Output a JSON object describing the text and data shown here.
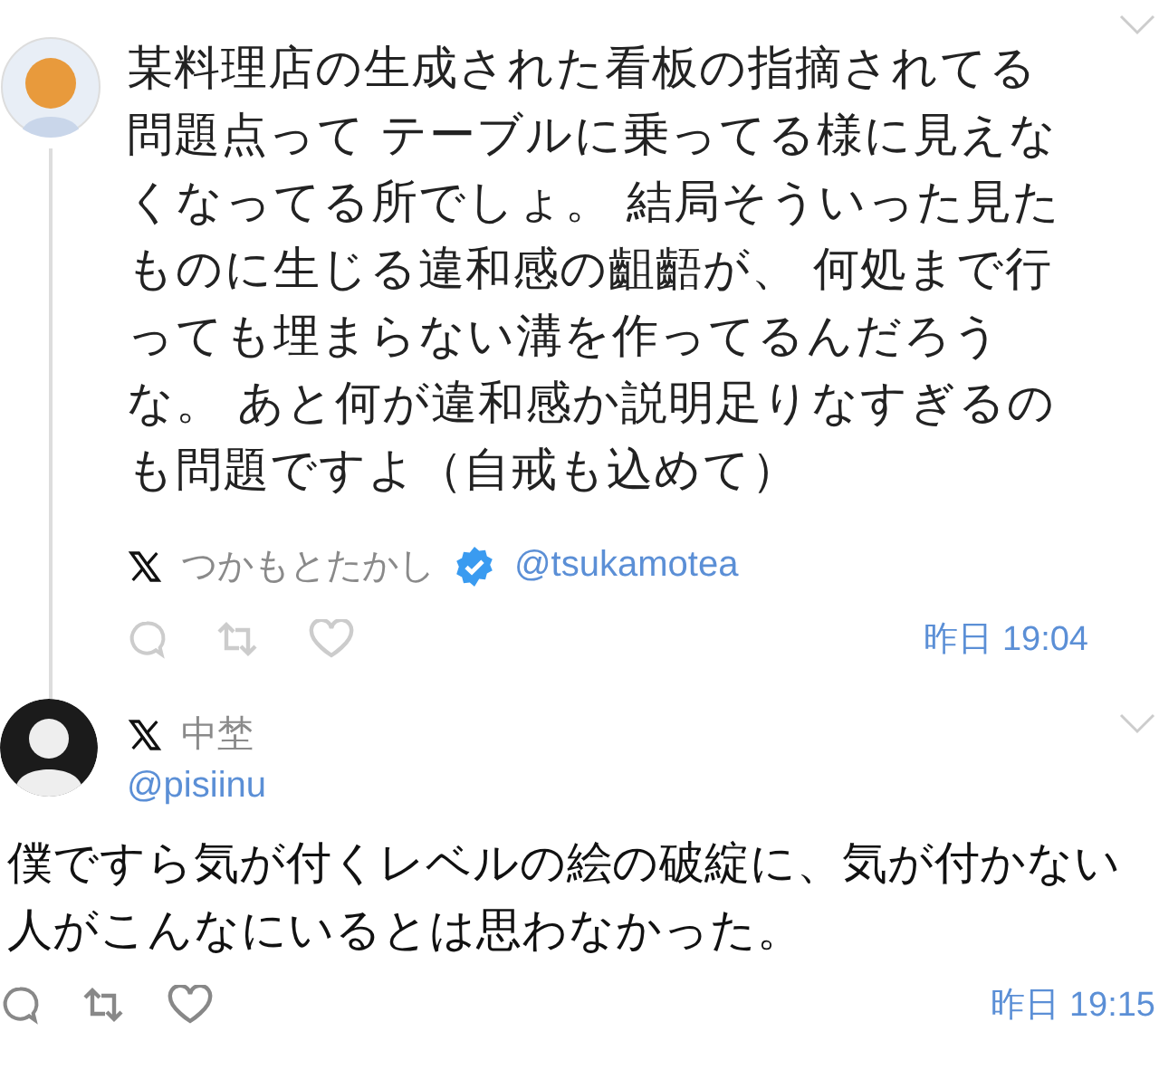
{
  "tweets": [
    {
      "kind": "indented",
      "text": "某料理店の生成された看板の指摘されてる問題点って テーブルに乗ってる様に見えなくなってる所でしょ。 結局そういった見たものに生じる違和感の齟齬が、 何処まで行っても埋まらない溝を作ってるんだろうな。 あと何が違和感か説明足りなすぎるのも問題ですよ（自戒も込めて）",
      "name": "つかもとたかし",
      "verified": true,
      "handle": "@tsukamotea",
      "time": "昨日 19:04"
    },
    {
      "kind": "full",
      "name": "中埜",
      "verified": false,
      "handle": "@pisiinu",
      "text": "僕ですら気が付くレベルの絵の破綻に、気が付かない人がこんなにいるとは思わなかった。",
      "time": "昨日 19:15"
    }
  ]
}
